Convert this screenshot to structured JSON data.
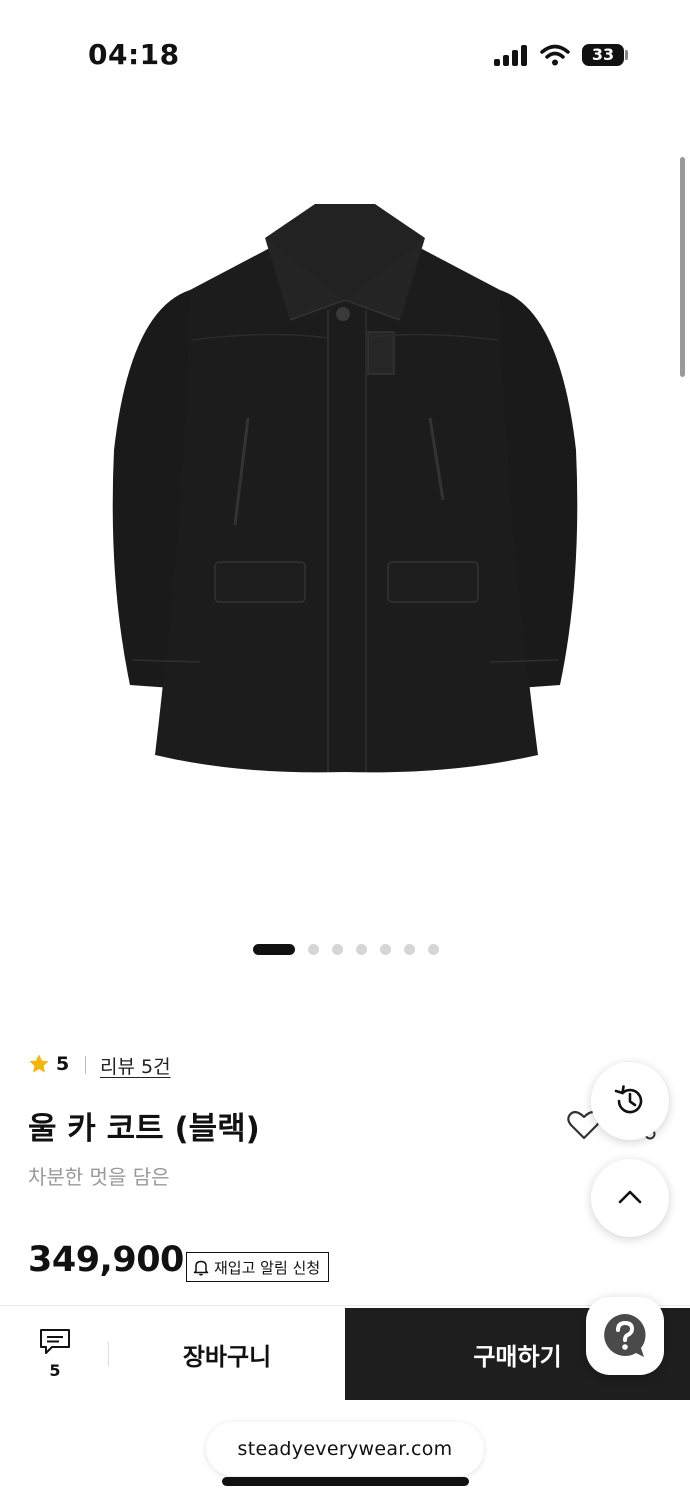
{
  "status_bar": {
    "time": "04:18",
    "battery": "33"
  },
  "carousel": {
    "slide_count": 7,
    "active_index": 0
  },
  "product": {
    "rating": "5",
    "review_link": "리뷰 5건",
    "title": "울 카 코트 (블랙)",
    "subtitle": "차분한 멋을 담은",
    "price": "349,900",
    "restock_button": "재입고 알림 신청"
  },
  "bottom_bar": {
    "comment_count": "5",
    "cart_label": "장바구니",
    "buy_label": "구매하기"
  },
  "browser": {
    "url": "steadyeverywear.com"
  },
  "colors": {
    "accent_star": "#f5b50a",
    "buy_button": "#1e1e1e"
  }
}
